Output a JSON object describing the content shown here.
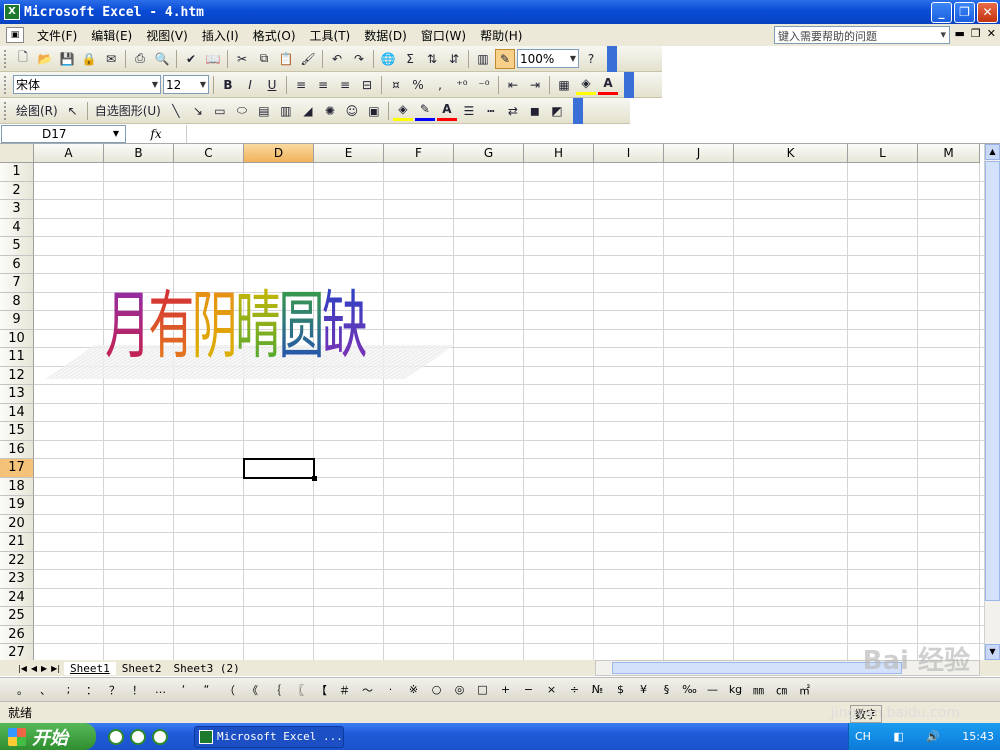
{
  "window": {
    "title": "Microsoft Excel - 4.htm",
    "app_icon": "X"
  },
  "menu": {
    "items": [
      "文件(F)",
      "编辑(E)",
      "视图(V)",
      "插入(I)",
      "格式(O)",
      "工具(T)",
      "数据(D)",
      "窗口(W)",
      "帮助(H)"
    ],
    "help_placeholder": "键入需要帮助的问题"
  },
  "standard_toolbar": {
    "zoom": "100%"
  },
  "formatting_toolbar": {
    "font": "宋体",
    "size": "12",
    "bold": "B",
    "italic": "I",
    "underline": "U",
    "percent": "%",
    "comma": ","
  },
  "drawing_toolbar": {
    "draw_label": "绘图(R)",
    "autoshapes_label": "自选图形(U)"
  },
  "formula_bar": {
    "name_box": "D17",
    "fx": "fx",
    "formula": ""
  },
  "grid": {
    "columns": [
      "A",
      "B",
      "C",
      "D",
      "E",
      "F",
      "G",
      "H",
      "I",
      "J",
      "K",
      "L",
      "M"
    ],
    "rows": [
      "1",
      "2",
      "3",
      "4",
      "5",
      "6",
      "7",
      "8",
      "9",
      "10",
      "11",
      "12",
      "13",
      "14",
      "15",
      "16",
      "17",
      "18",
      "19",
      "20",
      "21",
      "22",
      "23",
      "24",
      "25",
      "26",
      "27"
    ],
    "selected_column": "D",
    "selected_row": "17"
  },
  "wordart": {
    "chars": [
      "月",
      "有",
      "阴",
      "晴",
      "圆",
      "缺"
    ],
    "colors": [
      "#8b2fb3",
      "#d0203c",
      "#e88a18",
      "#d9b800",
      "#3aa63a",
      "#2244c4"
    ]
  },
  "sheets": {
    "tabs": [
      "Sheet1",
      "Sheet2",
      "Sheet3 (2)"
    ],
    "active": 0
  },
  "symbols": [
    "。",
    "、",
    ";",
    "：",
    "？",
    "！",
    "…",
    "‘",
    "“",
    "（",
    "《",
    "｛",
    "〖",
    "【",
    "＃",
    "～",
    "·",
    "※",
    "○",
    "◎",
    "□",
    "+",
    "−",
    "×",
    "÷",
    "№",
    "$",
    "¥",
    "§",
    "‰",
    "—",
    "kg",
    "㎜",
    "㎝",
    "㎡"
  ],
  "status": {
    "left": "就绪",
    "right": "数字"
  },
  "taskbar": {
    "start": "开始",
    "task": "Microsoft Excel ...",
    "lang": "CH",
    "time": "15:43"
  },
  "watermark": {
    "brand": "Bai 经验",
    "url": "jingyan.baidu.com"
  }
}
